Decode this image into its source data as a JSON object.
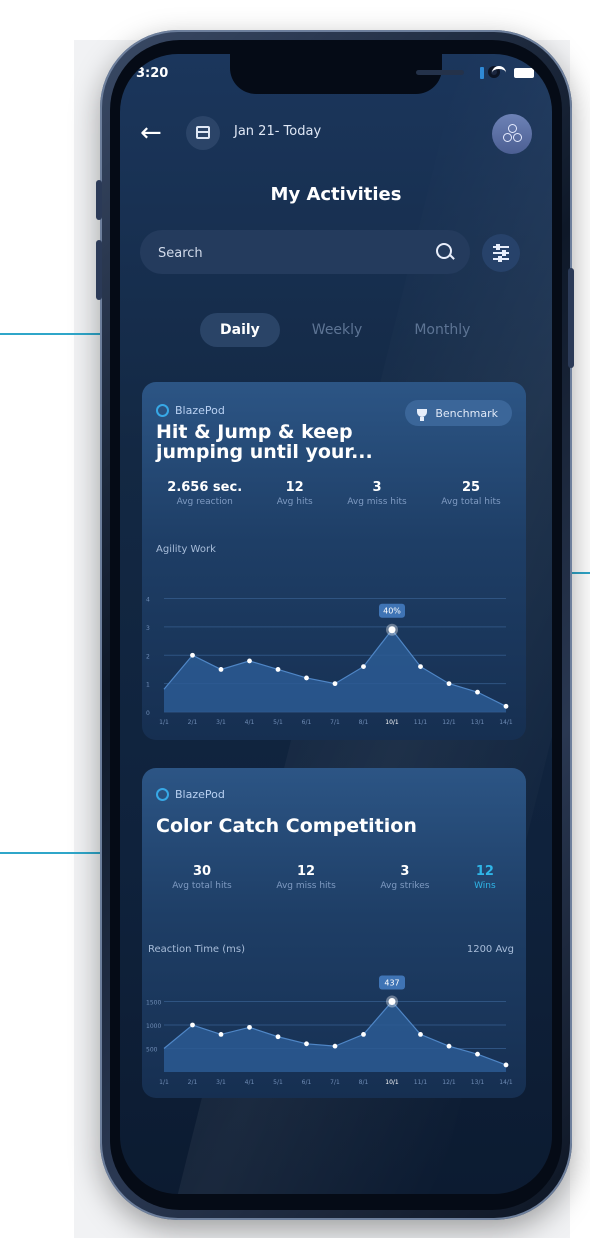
{
  "status_bar": {
    "time": "3:20"
  },
  "header": {
    "date_range": "Jan 21- Today",
    "title": "My Activities"
  },
  "search": {
    "placeholder": "Search"
  },
  "tabs": [
    {
      "label": "Daily",
      "active": true
    },
    {
      "label": "Weekly",
      "active": false
    },
    {
      "label": "Monthly",
      "active": false
    }
  ],
  "cards": [
    {
      "brand": "BlazePod",
      "title_lines": [
        "Hit & Jump & keep",
        "jumping until your..."
      ],
      "benchmark_label": "Benchmark",
      "stats": [
        {
          "value": "2.656 sec.",
          "label": "Avg reaction"
        },
        {
          "value": "12",
          "label": "Avg hits"
        },
        {
          "value": "3",
          "label": "Avg miss hits"
        },
        {
          "value": "25",
          "label": "Avg total hits"
        }
      ],
      "chart_label": "Agility Work"
    },
    {
      "brand": "BlazePod",
      "title": "Color Catch Competition",
      "stats": [
        {
          "value": "30",
          "label": "Avg total hits"
        },
        {
          "value": "12",
          "label": "Avg miss hits"
        },
        {
          "value": "3",
          "label": "Avg strikes"
        },
        {
          "value": "12",
          "label": "Wins"
        }
      ],
      "chart_label": "Reaction Time (ms)",
      "chart_avg": "1200 Avg"
    }
  ],
  "chart_data": [
    {
      "type": "area",
      "title": "Agility Work",
      "x": [
        "1/1",
        "2/1",
        "3/1",
        "4/1",
        "5/1",
        "6/1",
        "7/1",
        "8/1",
        "10/1",
        "11/1",
        "12/1",
        "13/1",
        "14/1"
      ],
      "values": [
        0.8,
        2.0,
        1.5,
        1.8,
        1.5,
        1.2,
        1.0,
        1.6,
        2.9,
        1.6,
        1.0,
        0.7,
        0.2
      ],
      "highlight": {
        "index": 8,
        "label": "40%"
      },
      "y_ticks": [
        "0",
        "1",
        "2",
        "3",
        "4"
      ],
      "ylim": [
        0,
        4.3
      ],
      "accent_color": "#2fb6e8"
    },
    {
      "type": "area",
      "title": "Reaction Time (ms)",
      "x": [
        "1/1",
        "2/1",
        "3/1",
        "4/1",
        "5/1",
        "6/1",
        "7/1",
        "8/1",
        "10/1",
        "11/1",
        "12/1",
        "13/1",
        "14/1"
      ],
      "values": [
        500,
        1000,
        800,
        950,
        750,
        600,
        550,
        800,
        1500,
        800,
        550,
        380,
        150
      ],
      "highlight": {
        "index": 8,
        "label": "437"
      },
      "y_ticks": [
        "500",
        "1000",
        "1500"
      ],
      "ylim": [
        0,
        2000
      ],
      "accent_color": "#2fb6e8"
    }
  ]
}
